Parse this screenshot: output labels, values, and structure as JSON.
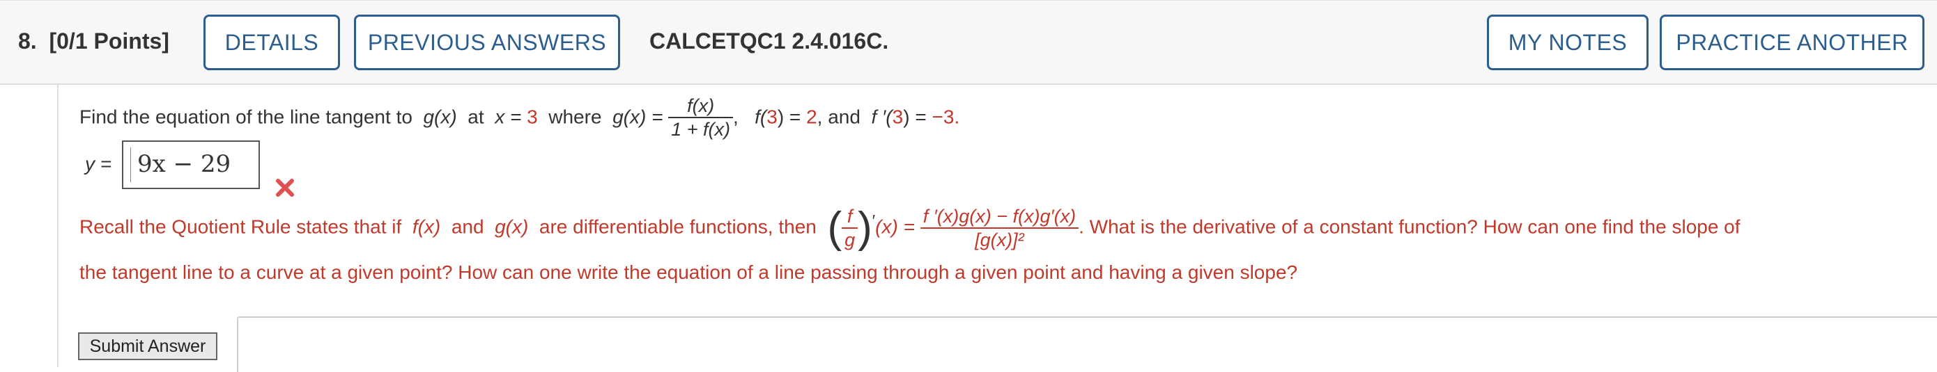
{
  "header": {
    "question_number": "8.",
    "points": "[0/1 Points]",
    "details_label": "DETAILS",
    "previous_answers_label": "PREVIOUS ANSWERS",
    "question_code": "CALCETQC1 2.4.016C.",
    "my_notes_label": "MY NOTES",
    "practice_another_label": "PRACTICE ANOTHER"
  },
  "question": {
    "intro": "Find the equation of the line tangent to",
    "g_of_x": "g(x)",
    "at": "at",
    "x_eq": "x =",
    "x_val": "3",
    "where": "where",
    "g_eq": "g(x) =",
    "frac_num": "f(x)",
    "frac_den": "1 + f(x)",
    "comma1": ",",
    "f3_pre": "f(",
    "f3_arg": "3",
    "f3_post": ") =",
    "f3_val": "2",
    "and_text": ", and",
    "fp3_pre": "f ′(",
    "fp3_arg": "3",
    "fp3_post": ") =",
    "fp3_val": "−3",
    "period": "."
  },
  "answer": {
    "label": "y =",
    "value": "9x − 29",
    "status": "incorrect"
  },
  "hint": {
    "line1_a": "Recall the Quotient Rule states that if",
    "f_of_x": "f(x)",
    "and": "and",
    "g_of_x": "g(x)",
    "line1_b": "are differentiable functions, then",
    "qr_num": "f",
    "qr_den": "g",
    "prime": "′",
    "of_x": "(x) =",
    "rhs_num": "f ′(x)g(x) − f(x)g′(x)",
    "rhs_den": "[g(x)]²",
    "line1_c": ". What is the derivative of a constant function? How can one find the slope of",
    "line2": "the tangent line to a curve at a given point? How can one write the equation of a line passing through a given point and having a given slope?"
  },
  "submit_label": "Submit Answer",
  "colors": {
    "accent": "#2c5d8f",
    "error": "#c0392b",
    "header_bg": "#f7f7f7"
  }
}
